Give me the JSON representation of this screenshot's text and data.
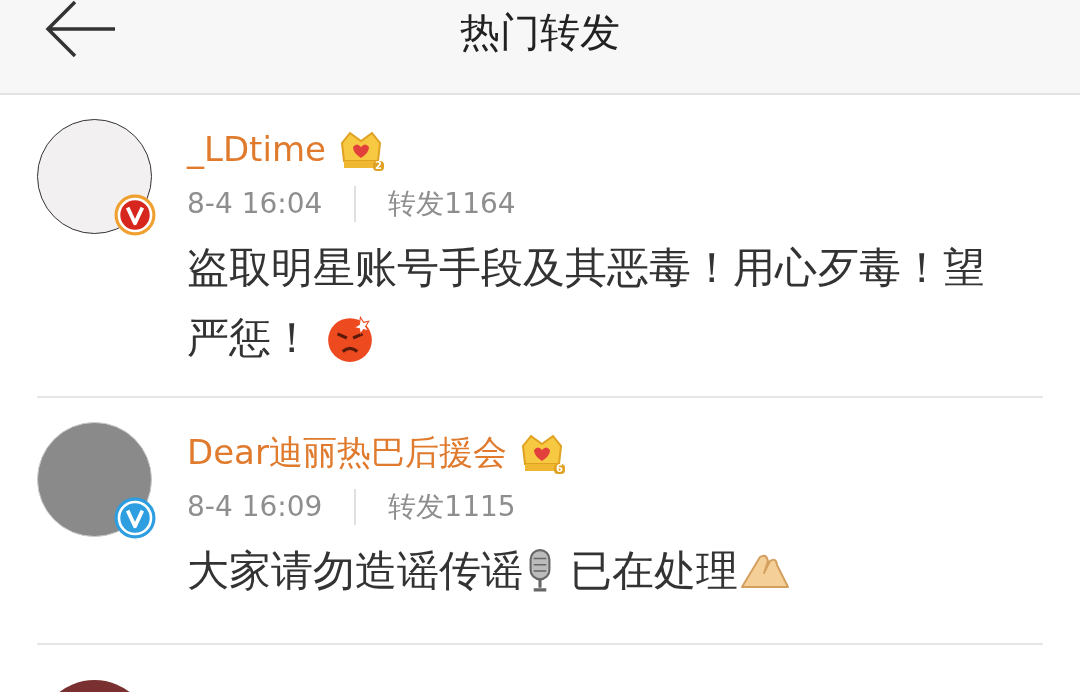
{
  "header": {
    "title": "热门转发"
  },
  "posts": [
    {
      "name": "_LDtime",
      "crown_level": "2",
      "color": "#f0a030",
      "time": "8-4 16:04",
      "reposts": "转发1164",
      "lines": [
        [
          {
            "kind": "text",
            "text": "盗取明星账号手段及其恶毒！用心歹毒！望"
          }
        ],
        [
          {
            "kind": "text",
            "text": "严惩！"
          },
          {
            "kind": "angry"
          }
        ]
      ]
    },
    {
      "name": "Dear迪丽热巴后援会",
      "crown_level": "6",
      "color": "#2d9ee0",
      "time": "8-4 16:09",
      "reposts": "转发1115",
      "lines": [
        [
          {
            "kind": "text",
            "text": "大家请勿造谣传谣"
          },
          {
            "kind": "mic"
          },
          {
            "kind": "text",
            "text": " 已在处理"
          },
          {
            "kind": "hands"
          }
        ]
      ]
    }
  ]
}
